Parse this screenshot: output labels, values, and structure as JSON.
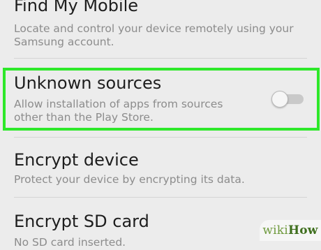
{
  "settings": {
    "items": [
      {
        "title": "Find My Mobile",
        "description_line1": "Locate and control your device remotely using your",
        "description_line2": "Samsung account."
      },
      {
        "title": "Unknown sources",
        "description_line1": "Allow installation of apps from sources",
        "description_line2": "other than the Play Store.",
        "toggle_state": "off"
      },
      {
        "title": "Encrypt device",
        "description_line1": "Protect your device by encrypting its data."
      },
      {
        "title": "Encrypt SD card",
        "description_line1": "No SD card inserted."
      }
    ]
  },
  "highlight": {
    "color": "#2ee82a"
  },
  "watermark": {
    "wiki": "wiki",
    "how": "How"
  }
}
